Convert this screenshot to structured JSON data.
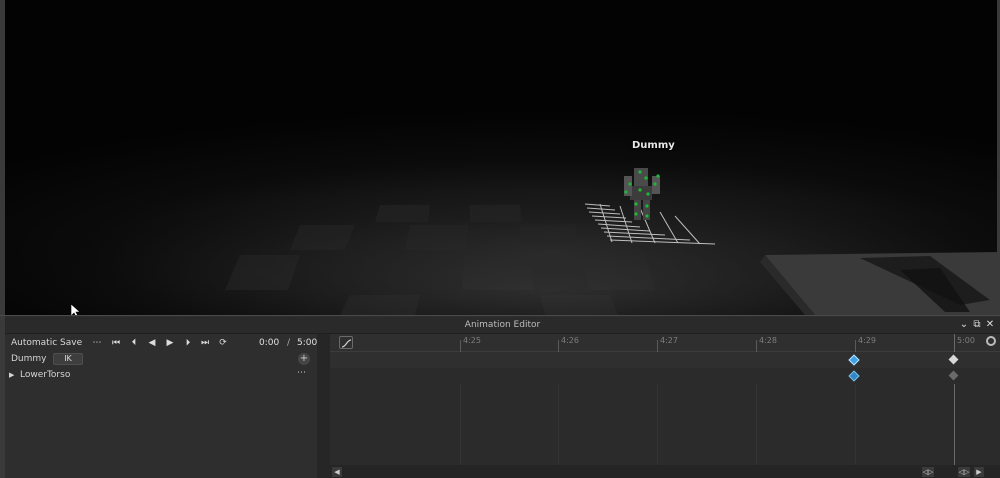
{
  "viewport": {
    "model_label": "Dummy"
  },
  "editor": {
    "title": "Animation Editor",
    "window_controls": {
      "collapse": "⌄",
      "popout": "⧉",
      "close": "✕"
    },
    "toolbar": {
      "save_mode": "Automatic Save",
      "more": "⋯",
      "skip_start": "⏮",
      "prev_key": "⏴",
      "play_back": "◀",
      "play": "▶",
      "next_key": "⏵",
      "skip_end": "⏭",
      "loop": "⟳",
      "current_time": "0:00",
      "separator": "/",
      "end_time": "5:00"
    },
    "tracks": {
      "root": {
        "name": "Dummy",
        "ik_label": "IK",
        "add": "+"
      },
      "items": [
        {
          "expander": "▶",
          "name": "LowerTorso",
          "more": "⋯"
        }
      ]
    },
    "timeline": {
      "ticks": [
        "4:25",
        "4:26",
        "4:27",
        "4:28",
        "4:29",
        "5:00"
      ],
      "keyframes": [
        {
          "track": "Dummy",
          "time": "4:29",
          "selected": true
        },
        {
          "track": "Dummy",
          "time": "5:00",
          "selected": false
        },
        {
          "track": "LowerTorso",
          "time": "4:29",
          "selected": true
        },
        {
          "track": "LowerTorso",
          "time": "5:00",
          "selected": false
        }
      ],
      "scroll": {
        "left": "◀",
        "zoom_a": "◁▷",
        "zoom_b": "◁▷",
        "right": "▶"
      }
    },
    "colors": {
      "selected_key": "#3fa1e8",
      "unselected_key": "#d8d8d8",
      "panel_bg": "#2e2e2e"
    },
    "icons": [
      "curve-editor-icon",
      "settings-icon",
      "cursor-icon"
    ]
  }
}
